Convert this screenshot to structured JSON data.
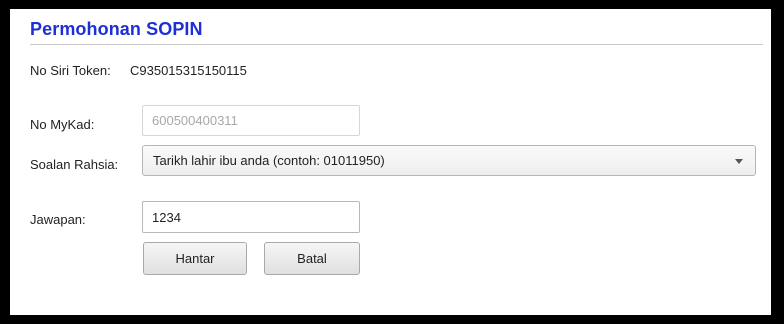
{
  "panel": {
    "title": "Permohonan SOPIN"
  },
  "token": {
    "label": "No Siri Token:",
    "value": "C935015315150115"
  },
  "mykad": {
    "label": "No MyKad:",
    "value": "600500400311"
  },
  "secret_question": {
    "label": "Soalan Rahsia:",
    "selected": "Tarikh lahir ibu anda (contoh: 01011950)"
  },
  "answer": {
    "label": "Jawapan:",
    "value": "1234"
  },
  "buttons": {
    "submit": "Hantar",
    "cancel": "Batal"
  },
  "colors": {
    "title": "#1f2fd6",
    "frame": "#000000"
  }
}
